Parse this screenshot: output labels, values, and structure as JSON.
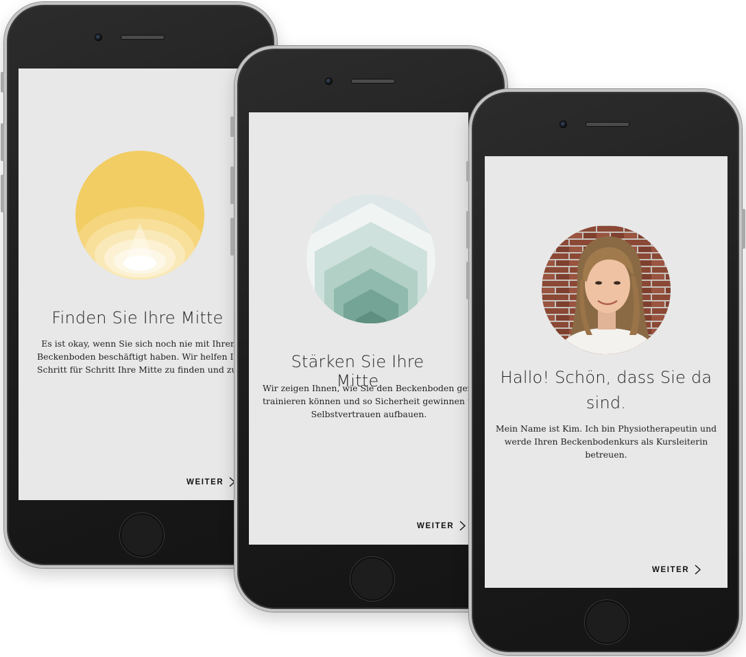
{
  "screens": [
    {
      "title": "Finden Sie Ihre Mitte",
      "body": [
        "Es ist okay, wenn Sie sich noch nie mit Ihrem",
        "Beckenboden beschäftigt haben. Wir helfen Ihnen",
        "Schritt für Schritt Ihre Mitte zu finden und zu spüren."
      ],
      "next_label": "WEITER",
      "illustration": "sun-circle-illustration",
      "accent": "#f2cd63"
    },
    {
      "title": "Stärken Sie Ihre Mitte",
      "body": [
        "Wir zeigen Ihnen, wie Sie den Beckenboden gezielt",
        "trainieren können und so Sicherheit gewinnen und",
        "Selbstvertrauen aufbauen."
      ],
      "next_label": "WEITER",
      "illustration": "layered-chevron-illustration",
      "accent": "#6a9f8f"
    },
    {
      "title_lines": [
        "Hallo! Schön, dass Sie da",
        "sind."
      ],
      "body": [
        "Mein Name ist Kim. Ich bin Physiotherapeutin und",
        "werde Ihren Beckenbodenkurs als Kursleiterin",
        "betreuen."
      ],
      "next_label": "WEITER",
      "illustration": "trainer-portrait-photo"
    }
  ],
  "colors": {
    "screen_bg": "#e8e8e8",
    "device": "#1d1d1d",
    "frame": "#c4c4c4"
  }
}
